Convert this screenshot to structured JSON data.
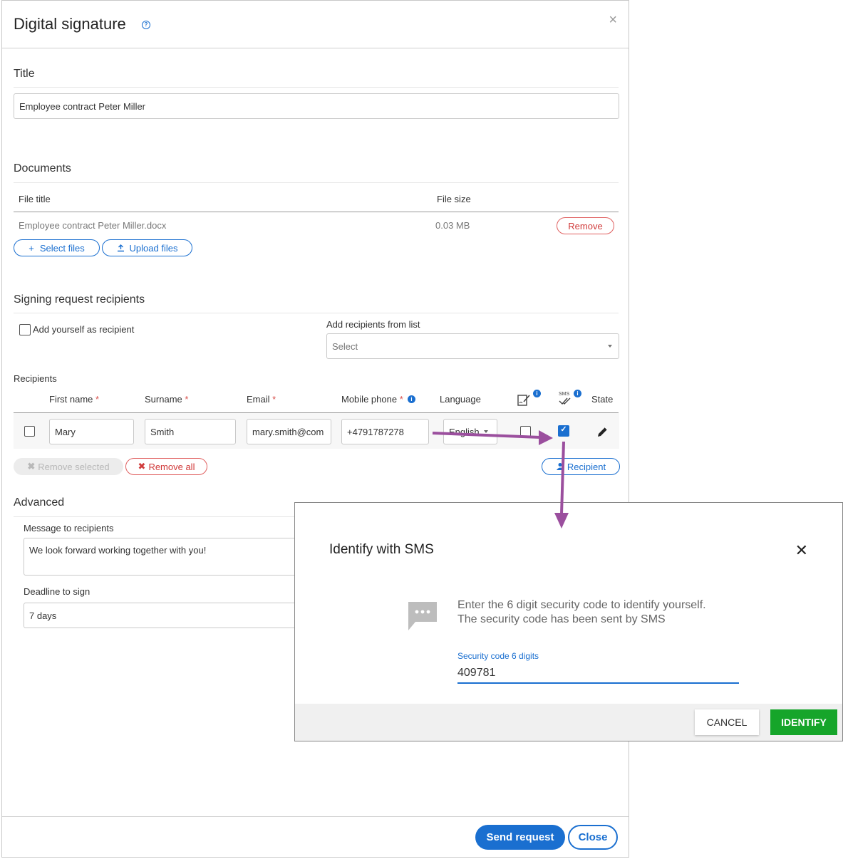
{
  "dialog": {
    "title": "Digital signature",
    "help_glyph": "?",
    "close_glyph": "×"
  },
  "title_section": {
    "heading": "Title",
    "value": "Employee contract Peter Miller"
  },
  "documents": {
    "heading": "Documents",
    "columns": [
      "File title",
      "File size"
    ],
    "rows": [
      {
        "title": "Employee contract Peter Miller.docx",
        "size": "0.03 MB",
        "action": "Remove"
      }
    ],
    "select_files": "Select files",
    "upload_files": "Upload files"
  },
  "recipients_section": {
    "heading": "Signing request recipients",
    "add_yourself": "Add yourself as recipient",
    "add_from_list_label": "Add recipients from list",
    "add_from_list_placeholder": "Select",
    "recipients_label": "Recipients",
    "columns": {
      "first_name": "First name",
      "surname": "Surname",
      "email": "Email",
      "mobile": "Mobile phone",
      "language": "Language",
      "sms": "SMS",
      "state": "State",
      "required": "*"
    },
    "row": {
      "first_name": "Mary",
      "surname": "Smith",
      "email": "mary.smith@com",
      "mobile": "+4791787278",
      "language": "English",
      "sms_checked": true
    },
    "remove_selected": "Remove selected",
    "remove_all": "Remove all",
    "add_recipient": "Recipient"
  },
  "advanced": {
    "heading": "Advanced",
    "message_label": "Message to recipients",
    "message_value": "We look forward working together with you!",
    "deadline_label": "Deadline to sign",
    "deadline_value": "7 days"
  },
  "footer": {
    "send": "Send request",
    "close": "Close"
  },
  "sms_modal": {
    "title": "Identify with SMS",
    "close_glyph": "✕",
    "message_line1": "Enter the 6 digit security code to identify yourself.",
    "message_line2": "The security code has been sent by SMS",
    "field_label": "Security code 6 digits",
    "field_value": "409781",
    "cancel": "CANCEL",
    "identify": "IDENTIFY"
  },
  "colors": {
    "accent": "#1a6fd0",
    "danger": "#d03a3a",
    "success": "#16a52a",
    "arrow": "#9b4f9e"
  }
}
